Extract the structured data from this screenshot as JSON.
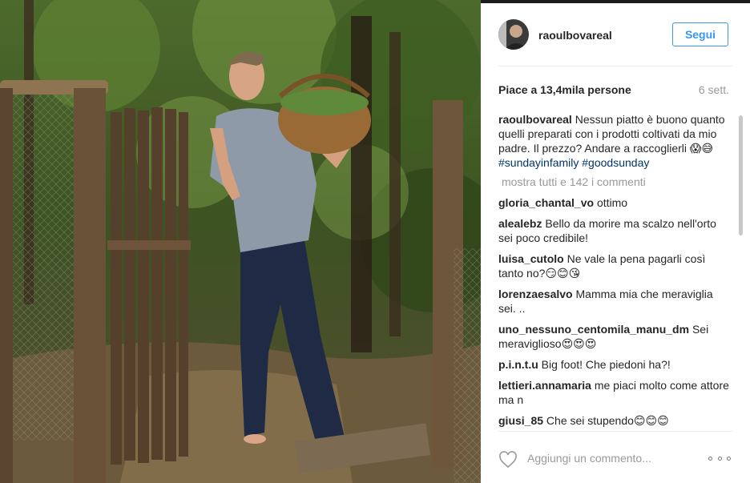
{
  "post": {
    "username": "raoulbovareal",
    "follow_label": "Segui",
    "likes": "Piace a 13,4mila persone",
    "age": "6 sett."
  },
  "caption": {
    "user": "raoulbovareal",
    "text": "Nessun piatto è buono quanto quelli preparati con i prodotti coltivati da mio padre. Il prezzo? Andare a raccoglierli 😱😅",
    "hashtags": "#sundayinfamily #goodsunday"
  },
  "show_all": "mostra tutti e 142 i commenti",
  "comments": [
    {
      "user": "gloria_chantal_vo",
      "text": "ottimo"
    },
    {
      "user": "alealebz",
      "text": "Bello da morire ma scalzo nell'orto sei poco credibile!"
    },
    {
      "user": "luisa_cutolo",
      "text": "Ne vale la pena pagarli così tanto no?😏😊😘"
    },
    {
      "user": "lorenzaesalvo",
      "text": "Mamma mia che meraviglia sei. .."
    },
    {
      "user": "uno_nessuno_centomila_manu_dm",
      "text": "Sei meraviglioso😍😍😍"
    },
    {
      "user": "p.i.n.t.u",
      "text": "Big foot! Che piedoni ha?!"
    },
    {
      "user": "lettieri.annamaria",
      "text": "me piaci molto come attore ma n"
    },
    {
      "user": "giusi_85",
      "text": "Che sei stupendo😊😊😊"
    }
  ],
  "footer": {
    "placeholder": "Aggiungi un commento...",
    "like_icon": "heart-outline-icon",
    "more_icon": "more-options-icon"
  },
  "colors": {
    "accent": "#3897f0",
    "hashtag": "#003569",
    "muted": "#999999"
  }
}
